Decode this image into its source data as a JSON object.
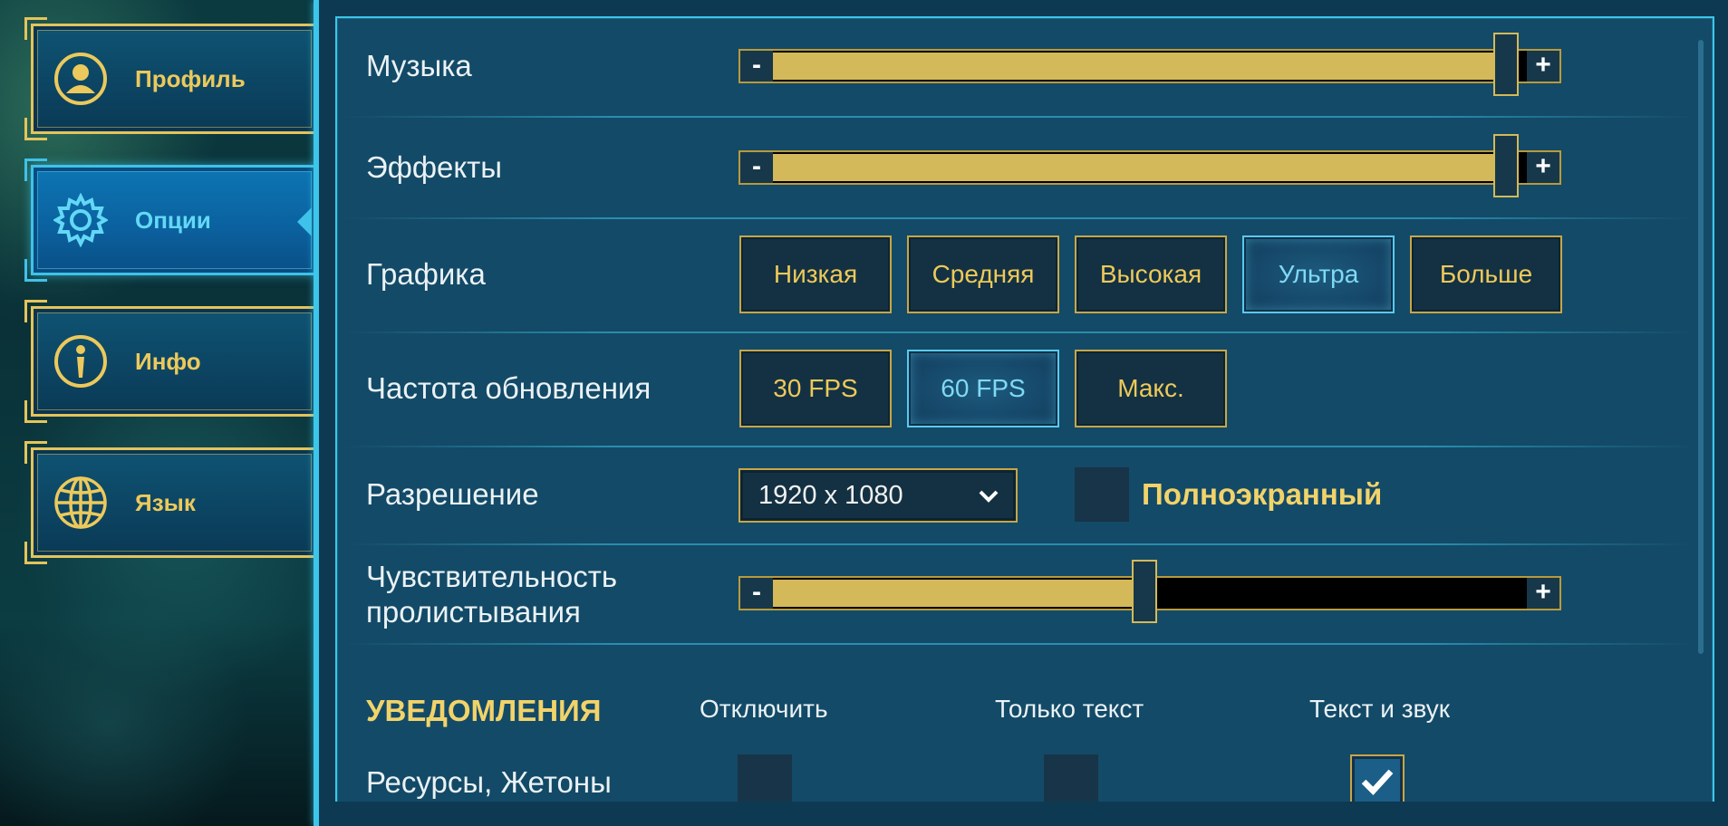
{
  "side_menu": {
    "items": [
      {
        "label": "Профиль",
        "icon": "profile-icon",
        "active": false
      },
      {
        "label": "Опции",
        "icon": "gear-icon",
        "active": true
      },
      {
        "label": "Инфо",
        "icon": "info-icon",
        "active": false
      },
      {
        "label": "Язык",
        "icon": "globe-icon",
        "active": false
      }
    ]
  },
  "settings": {
    "music": {
      "label": "Музыка",
      "value_fraction": 0.97
    },
    "effects": {
      "label": "Эффекты",
      "value_fraction": 0.97
    },
    "graphics": {
      "label": "Графика",
      "options": [
        "Низкая",
        "Средняя",
        "Высокая",
        "Ультра",
        "Больше"
      ],
      "selected": "Ультра"
    },
    "refresh_rate": {
      "label": "Частота обновления",
      "options": [
        "30 FPS",
        "60 FPS",
        "Макс."
      ],
      "selected": "60 FPS"
    },
    "resolution": {
      "label": "Разрешение",
      "value": "1920 x 1080",
      "fullscreen_label": "Полноэкранный",
      "fullscreen_checked": false
    },
    "scroll_sensitivity": {
      "label_line1": "Чувствительность",
      "label_line2": "пролистывания",
      "value_fraction": 0.49
    },
    "slider_minus": "-",
    "slider_plus": "+"
  },
  "notifications": {
    "heading": "УВЕДОМЛЕНИЯ",
    "columns": [
      "Отключить",
      "Только текст",
      "Текст и звук"
    ],
    "rows": [
      {
        "label": "Ресурсы, Жетоны",
        "selected": "Текст и звук"
      }
    ]
  },
  "colors": {
    "accent_gold": "#d4b95a",
    "accent_cyan": "#3cc6ea",
    "panel_bg": "#134a67"
  }
}
